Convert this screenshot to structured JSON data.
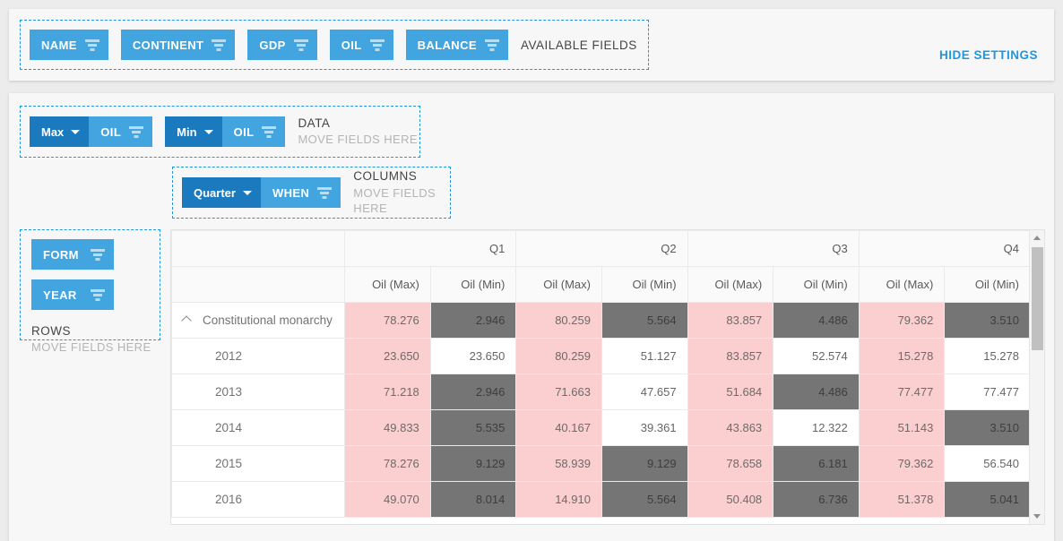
{
  "available": {
    "caption": "AVAILABLE FIELDS",
    "fields": [
      {
        "label": "NAME",
        "icon": "filter-icon"
      },
      {
        "label": "CONTINENT",
        "icon": "filter-icon"
      },
      {
        "label": "GDP",
        "icon": "filter-icon"
      },
      {
        "label": "OIL",
        "icon": "filter-icon"
      },
      {
        "label": "BALANCE",
        "icon": "filter-icon"
      }
    ]
  },
  "hide_settings_label": "HIDE SETTINGS",
  "data_zone": {
    "title": "DATA",
    "subtitle": "MOVE FIELDS HERE",
    "chips": [
      {
        "agg": "Max",
        "field": "OIL",
        "icon": "filter-icon",
        "caret": "chevron-down-icon"
      },
      {
        "agg": "Min",
        "field": "OIL",
        "icon": "filter-icon",
        "caret": "chevron-down-icon"
      }
    ]
  },
  "columns_zone": {
    "title": "COLUMNS",
    "subtitle": "MOVE FIELDS HERE",
    "chips": [
      {
        "agg": "Quarter",
        "field": "WHEN",
        "icon": "filter-icon",
        "caret": "chevron-down-icon"
      }
    ]
  },
  "rows_zone": {
    "title": "ROWS",
    "subtitle": "MOVE FIELDS HERE",
    "chips": [
      {
        "label": "FORM",
        "icon": "filter-icon"
      },
      {
        "label": "YEAR",
        "icon": "filter-icon"
      }
    ]
  },
  "grid": {
    "corner": "",
    "quarters": [
      "Q1",
      "Q2",
      "Q3",
      "Q4"
    ],
    "measures": [
      "Oil (Max)",
      "Oil (Min)"
    ],
    "columns": [
      "Oil (Max)",
      "Oil (Min)",
      "Oil (Max)",
      "Oil (Min)",
      "Oil (Max)",
      "Oil (Min)",
      "Oil (Max)",
      "Oil (Min)"
    ],
    "rows": [
      {
        "label": "Constitutional monarchy",
        "level": 0,
        "expanded": true,
        "collapse_icon": "chevron-up-icon",
        "cells": [
          {
            "v": "78.276",
            "fmt": "pink"
          },
          {
            "v": "2.946",
            "fmt": "gray"
          },
          {
            "v": "80.259",
            "fmt": "pink"
          },
          {
            "v": "5.564",
            "fmt": "gray"
          },
          {
            "v": "83.857",
            "fmt": "pink"
          },
          {
            "v": "4.486",
            "fmt": "gray"
          },
          {
            "v": "79.362",
            "fmt": "pink"
          },
          {
            "v": "3.510",
            "fmt": "gray"
          }
        ]
      },
      {
        "label": "2012",
        "level": 1,
        "cells": [
          {
            "v": "23.650",
            "fmt": "pink"
          },
          {
            "v": "23.650",
            "fmt": "none"
          },
          {
            "v": "80.259",
            "fmt": "pink"
          },
          {
            "v": "51.127",
            "fmt": "none"
          },
          {
            "v": "83.857",
            "fmt": "pink"
          },
          {
            "v": "52.574",
            "fmt": "none"
          },
          {
            "v": "15.278",
            "fmt": "pink"
          },
          {
            "v": "15.278",
            "fmt": "none"
          }
        ]
      },
      {
        "label": "2013",
        "level": 1,
        "cells": [
          {
            "v": "71.218",
            "fmt": "pink"
          },
          {
            "v": "2.946",
            "fmt": "gray"
          },
          {
            "v": "71.663",
            "fmt": "pink"
          },
          {
            "v": "47.657",
            "fmt": "none"
          },
          {
            "v": "51.684",
            "fmt": "pink"
          },
          {
            "v": "4.486",
            "fmt": "gray"
          },
          {
            "v": "77.477",
            "fmt": "pink"
          },
          {
            "v": "77.477",
            "fmt": "none"
          }
        ]
      },
      {
        "label": "2014",
        "level": 1,
        "cells": [
          {
            "v": "49.833",
            "fmt": "pink"
          },
          {
            "v": "5.535",
            "fmt": "gray"
          },
          {
            "v": "40.167",
            "fmt": "pink"
          },
          {
            "v": "39.361",
            "fmt": "none"
          },
          {
            "v": "43.863",
            "fmt": "pink"
          },
          {
            "v": "12.322",
            "fmt": "none"
          },
          {
            "v": "51.143",
            "fmt": "pink"
          },
          {
            "v": "3.510",
            "fmt": "gray"
          }
        ]
      },
      {
        "label": "2015",
        "level": 1,
        "cells": [
          {
            "v": "78.276",
            "fmt": "pink"
          },
          {
            "v": "9.129",
            "fmt": "gray"
          },
          {
            "v": "58.939",
            "fmt": "pink"
          },
          {
            "v": "9.129",
            "fmt": "gray"
          },
          {
            "v": "78.658",
            "fmt": "pink"
          },
          {
            "v": "6.181",
            "fmt": "gray"
          },
          {
            "v": "79.362",
            "fmt": "pink"
          },
          {
            "v": "56.540",
            "fmt": "none"
          }
        ]
      },
      {
        "label": "2016",
        "level": 1,
        "cells": [
          {
            "v": "49.070",
            "fmt": "pink"
          },
          {
            "v": "8.014",
            "fmt": "gray"
          },
          {
            "v": "14.910",
            "fmt": "pink"
          },
          {
            "v": "5.564",
            "fmt": "gray"
          },
          {
            "v": "50.408",
            "fmt": "pink"
          },
          {
            "v": "6.736",
            "fmt": "gray"
          },
          {
            "v": "51.378",
            "fmt": "pink"
          },
          {
            "v": "5.041",
            "fmt": "gray"
          }
        ]
      }
    ],
    "scrollbar": {
      "up_icon": "scroll-up-arrow-icon",
      "down_icon": "scroll-down-arrow-icon"
    }
  },
  "colors": {
    "chip_light": "#42a5e0",
    "chip_dark": "#1b79bd",
    "dropzone_border": "#2196d8",
    "link": "#1e97e0",
    "cell_pink": "#fbcfcf",
    "cell_gray": "#757575"
  }
}
